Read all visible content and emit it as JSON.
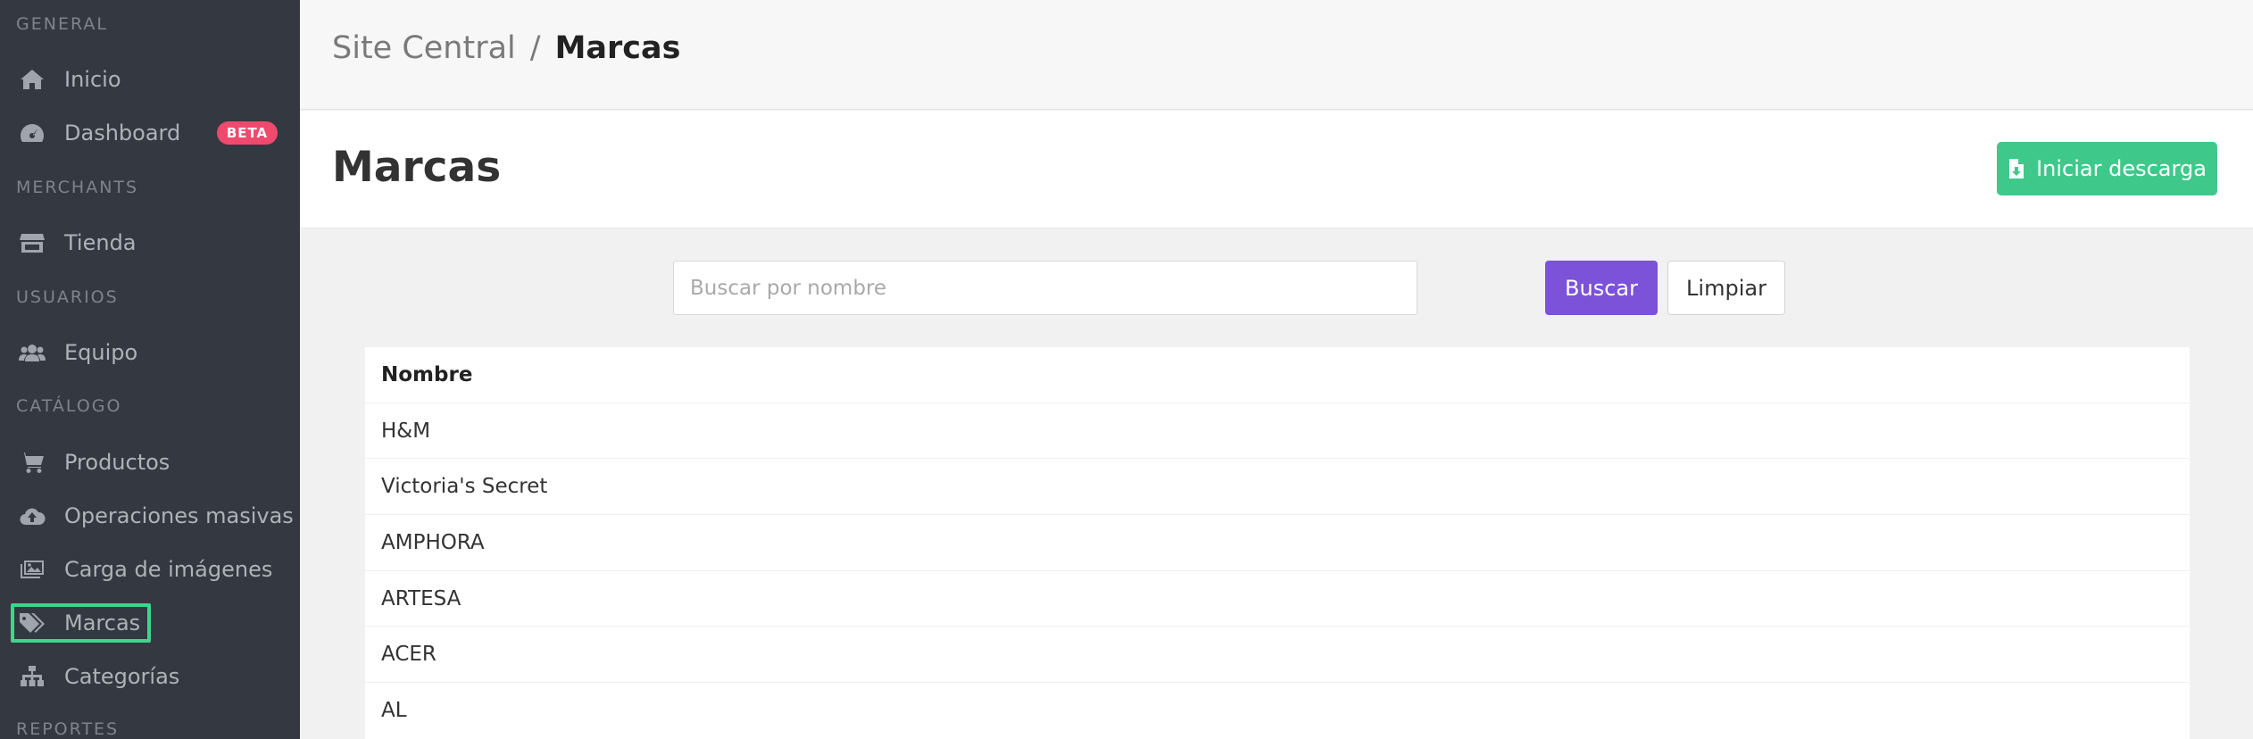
{
  "sidebar": {
    "sections": {
      "general": "GENERAL",
      "merchants": "MERCHANTS",
      "usuarios": "USUARIOS",
      "catalogo": "CATÁLOGO",
      "reportes": "REPORTES"
    },
    "items": {
      "inicio": "Inicio",
      "dashboard": "Dashboard",
      "dashboard_badge": "BETA",
      "tienda": "Tienda",
      "equipo": "Equipo",
      "productos": "Productos",
      "operaciones": "Operaciones masivas",
      "carga": "Carga de imágenes",
      "marcas": "Marcas",
      "categorias": "Categorías"
    }
  },
  "breadcrumb": {
    "parent": "Site Central",
    "separator": "/",
    "current": "Marcas"
  },
  "page": {
    "title": "Marcas",
    "download_label": "Iniciar descarga"
  },
  "search": {
    "placeholder": "Buscar por nombre",
    "value": "",
    "search_label": "Buscar",
    "clear_label": "Limpiar"
  },
  "table": {
    "header": "Nombre",
    "rows": [
      "H&M",
      "Victoria's Secret",
      "AMPHORA",
      "ARTESA",
      "ACER",
      "AL"
    ]
  },
  "colors": {
    "sidebar_bg": "#343841",
    "accent_green": "#3ec98a",
    "accent_purple": "#7b52d8",
    "badge_pink": "#ef4a6e"
  }
}
